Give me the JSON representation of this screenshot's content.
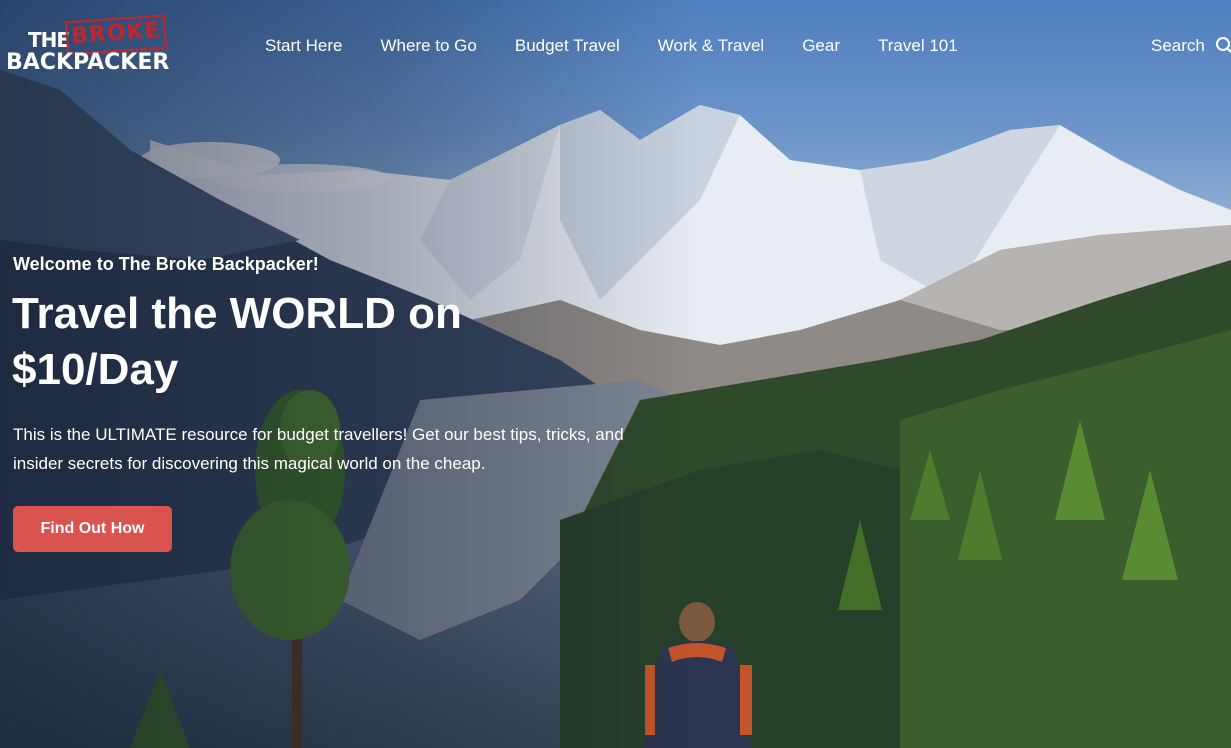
{
  "brand": {
    "the": "THE",
    "broke": "BROKE",
    "backpacker": "BACKPACKER",
    "stamp_color": "#c0272d"
  },
  "nav": {
    "items": [
      {
        "label": "Start Here"
      },
      {
        "label": "Where to Go"
      },
      {
        "label": "Budget Travel"
      },
      {
        "label": "Work & Travel"
      },
      {
        "label": "Gear"
      },
      {
        "label": "Travel 101"
      }
    ]
  },
  "search": {
    "label": "Search",
    "icon": "search-icon"
  },
  "hero": {
    "welcome": "Welcome to The Broke Backpacker!",
    "headline": "Travel the WORLD on $10/Day",
    "intro": "This is the ULTIMATE resource for budget travellers! Get our best tips, tricks, and insider secrets for discovering this magical world on the cheap.",
    "cta_label": "Find Out How",
    "cta_color": "#d9534f"
  }
}
